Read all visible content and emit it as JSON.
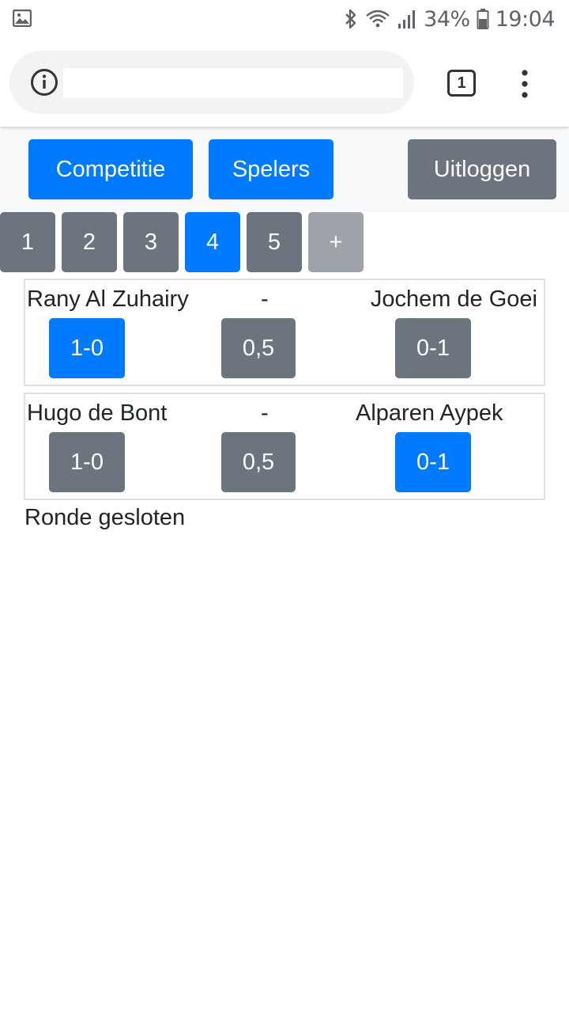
{
  "status_bar": {
    "left_icon": "image-icon",
    "battery_percent": "34%",
    "time": "19:04",
    "icons": [
      "bluetooth-icon",
      "wifi-icon",
      "signal-icon",
      "battery-icon"
    ]
  },
  "browser": {
    "url": "",
    "tab_count": "1",
    "icons": [
      "info-icon",
      "menu-dots-icon"
    ]
  },
  "header": {
    "competition_label": "Competitie",
    "players_label": "Spelers",
    "logout_label": "Uitloggen"
  },
  "rounds": {
    "items": [
      {
        "label": "1",
        "active": false
      },
      {
        "label": "2",
        "active": false
      },
      {
        "label": "3",
        "active": false
      },
      {
        "label": "4",
        "active": true
      },
      {
        "label": "5",
        "active": false
      }
    ],
    "add_label": "+"
  },
  "matches": [
    {
      "white": "Rany Al Zuhairy",
      "separator": "-",
      "black": "Jochem de Goei",
      "results": [
        "1-0",
        "0,5",
        "0-1"
      ],
      "selected": "1-0"
    },
    {
      "white": "Hugo de Bont",
      "separator": "-",
      "black": "Alparen Aypek",
      "results": [
        "1-0",
        "0,5",
        "0-1"
      ],
      "selected": "0-1"
    }
  ],
  "round_status": "Ronde gesloten",
  "colors": {
    "primary": "#007bff",
    "secondary": "#6c757d",
    "disabled": "#9ea4a9",
    "header_bg": "#f8f9fa"
  }
}
